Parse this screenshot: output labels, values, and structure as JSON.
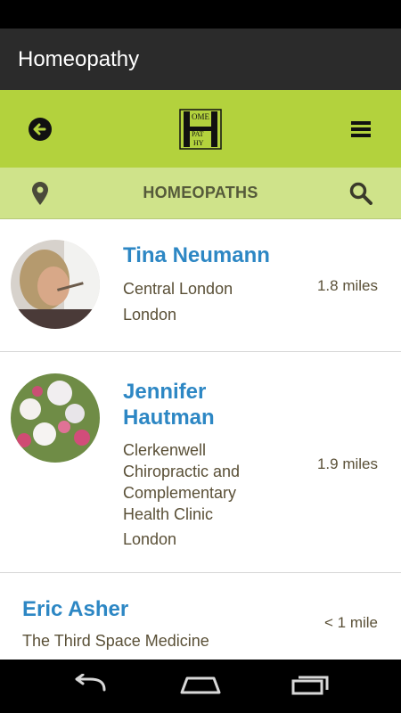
{
  "app": {
    "title": "Homeopathy"
  },
  "toolbar": {
    "back_icon": "back-arrow-icon",
    "menu_icon": "hamburger-menu-icon",
    "logo_text": "HOMEOPATHY"
  },
  "subbar": {
    "title": "HOMEOPATHS",
    "location_icon": "location-pin-icon",
    "search_icon": "search-icon"
  },
  "colors": {
    "toolbar": "#b3d23d",
    "subbar": "#cfe38a",
    "name": "#2d87c4",
    "text": "#5a5037"
  },
  "homeopaths": [
    {
      "name": "Tina Neumann",
      "address": "Central London",
      "city": "London",
      "distance": "1.8 miles"
    },
    {
      "name_line1": "Jennifer",
      "name_line2": "Hautman",
      "address_lines": [
        "Clerkenwell",
        "Chiropractic and",
        "Complementary",
        "Health Clinic"
      ],
      "city": "London",
      "distance": "1.9 miles"
    },
    {
      "name": "Eric Asher",
      "address": "The Third Space Medicine",
      "distance": "< 1 mile"
    }
  ]
}
